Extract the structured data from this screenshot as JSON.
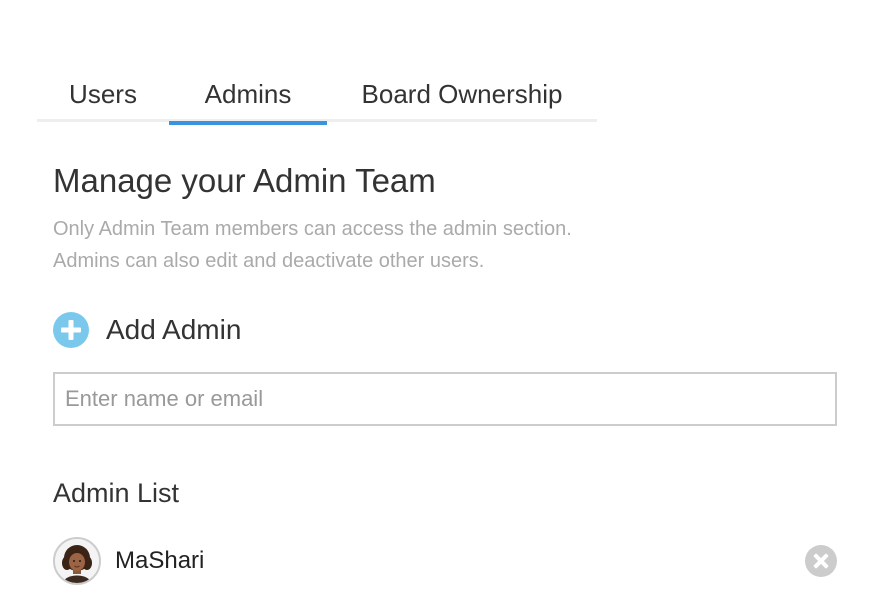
{
  "tabs": [
    {
      "label": "Users",
      "active": false
    },
    {
      "label": "Admins",
      "active": true
    },
    {
      "label": "Board Ownership",
      "active": false
    }
  ],
  "main": {
    "title": "Manage your Admin Team",
    "description_lines": [
      "Only Admin Team members can access the admin section.",
      "Admins can also edit and deactivate other users."
    ],
    "add_admin_label": "Add Admin",
    "search": {
      "placeholder": "Enter name or email",
      "value": ""
    },
    "list_heading": "Admin List",
    "admins": [
      {
        "name": "MaShari",
        "avatar": "avatar-icon"
      }
    ]
  },
  "colors": {
    "accent": "#3a93dd",
    "add_icon": "#7ac9ec",
    "muted_text": "#aaaaaa",
    "remove_icon": "#cccccc"
  },
  "icons": {
    "add": "plus-circle-icon",
    "remove": "close-circle-icon",
    "avatar": "avatar-icon"
  }
}
